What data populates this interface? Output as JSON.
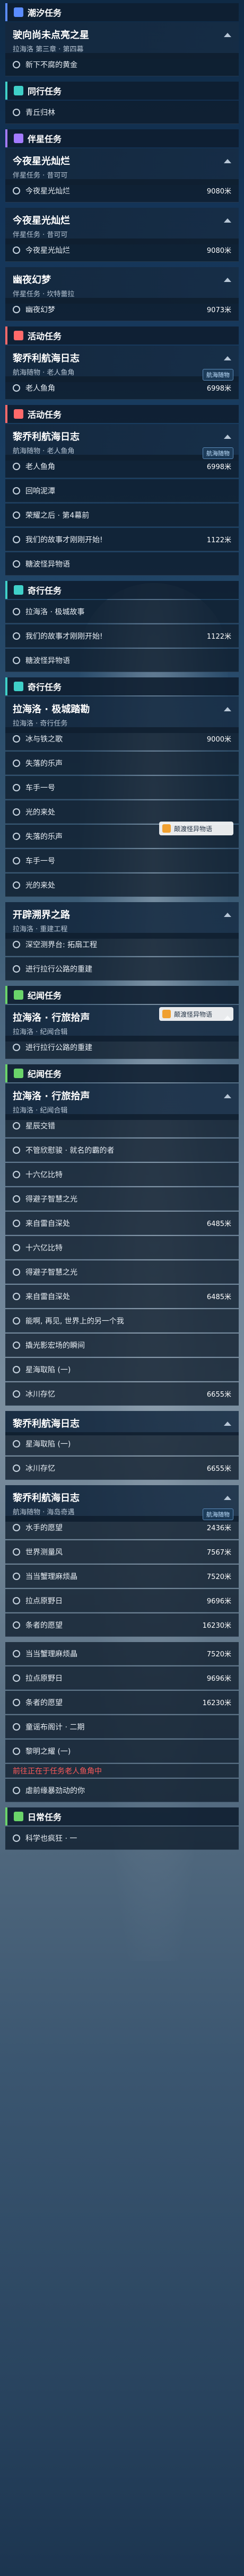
{
  "sections": [
    {
      "cat": "潮汐任务",
      "color": "blue",
      "title": "驶向尚未点亮之星",
      "sub": "拉海洛 第三章 · 第四幕",
      "rows": [
        {
          "label": "新下不腐的黄金"
        }
      ]
    },
    {
      "cat": "同行任务",
      "color": "teal",
      "rows": [
        {
          "label": "青丘归林"
        }
      ]
    },
    {
      "cat": "伴星任务",
      "color": "purple",
      "title": "今夜星光灿烂",
      "sub": "伴星任务 · 昔可可",
      "rows": [
        {
          "label": "今夜星光灿烂",
          "value": "9080米"
        }
      ]
    },
    {
      "cat": "",
      "color": "blue",
      "title": "今夜星光灿烂",
      "sub": "伴星任务 · 昔可可",
      "rows": [
        {
          "label": "今夜星光灿烂",
          "value": "9080米"
        }
      ]
    },
    {
      "cat": "",
      "color": "blue",
      "title": "幽夜幻梦",
      "sub": "伴星任务 · 坎特蕾拉",
      "rows": [
        {
          "label": "幽夜幻梦",
          "value": "9073米"
        }
      ]
    },
    {
      "cat": "活动任务",
      "color": "red",
      "title": "黎乔利航海日志",
      "sub": "航海随物 · 老人鱼角",
      "badge": "航海随物",
      "rows": [
        {
          "label": "老人鱼角",
          "value": "6998米"
        }
      ]
    },
    {
      "cat": "活动任务",
      "color": "red",
      "title": "黎乔利航海日志",
      "sub": "航海随物 · 老人鱼角",
      "badge": "航海随物",
      "rows": [
        {
          "label": "老人鱼角",
          "value": "6998米"
        },
        {
          "label": "回响泥潭"
        },
        {
          "label": "荣耀之后 · 第4幕前"
        },
        {
          "label": "我们的故事才刚刚开始!",
          "value": "1122米"
        },
        {
          "label": "糖波怪异物语"
        }
      ]
    },
    {
      "cat": "奇行任务",
      "color": "teal",
      "rows": [
        {
          "label": "拉海洛 · 极城故事"
        },
        {
          "label": "我们的故事才刚刚开始!",
          "value": "1122米"
        },
        {
          "label": "糖波怪异物语"
        }
      ]
    },
    {
      "cat": "奇行任务",
      "color": "teal",
      "title": "拉海洛 · 极城踏勘",
      "sub": "拉海洛 · 奇行任务",
      "rows": [
        {
          "label": "冰与铁之歌",
          "value": "9000米"
        },
        {
          "label": "失落的乐声"
        },
        {
          "label": "车手一号"
        },
        {
          "label": "光的来处"
        },
        {
          "label": "失落的乐声"
        },
        {
          "label": "车手一号"
        },
        {
          "label": "光的来处"
        }
      ]
    },
    {
      "cat": "",
      "color": "blue",
      "title": "开辟溯界之路",
      "sub": "拉海洛 · 重建工程",
      "rows": [
        {
          "label": "深空测界台: 拓扇工程"
        },
        {
          "label": "进行拉行公路的重建"
        }
      ]
    },
    {
      "cat": "纪闻任务",
      "color": "green",
      "title": "拉海洛 · 行旅拾声",
      "sub": "拉海洛 · 纪闻合辑",
      "rows": [
        {
          "label": "进行拉行公路的重建"
        }
      ]
    },
    {
      "cat": "纪闻任务",
      "color": "green",
      "title": "拉海洛 · 行旅拾声",
      "sub": "拉海洛 · 纪闻合辑",
      "rows": [
        {
          "label": "星辰交错"
        },
        {
          "label": "不管欣慰骏 · 就名的霸的者"
        },
        {
          "label": "十六亿比特"
        },
        {
          "label": "得避子智慧之光"
        },
        {
          "label": "来自雷自深处",
          "value": "6485米"
        },
        {
          "label": "十六亿比特"
        },
        {
          "label": "得避子智慧之光"
        },
        {
          "label": "来自雷自深处",
          "value": "6485米"
        },
        {
          "label": "能啊, 再见, 世界上的另一个我"
        },
        {
          "label": "撬光影宏场的瞬间"
        },
        {
          "label": "星海取陷 (一)"
        },
        {
          "label": "冰川存忆",
          "value": "6655米"
        }
      ]
    },
    {
      "cat": "",
      "color": "blue",
      "title": "黎乔利航海日志",
      "sub": "",
      "rows": [
        {
          "label": "星海取陷 (一)"
        },
        {
          "label": "冰川存忆",
          "value": "6655米"
        }
      ]
    },
    {
      "cat": "",
      "color": "blue",
      "title": "黎乔利航海日志",
      "sub": "航海随物 · 海岛奇遇",
      "badge": "航海随物",
      "rows": [
        {
          "label": "水手的愿望",
          "value": "2436米"
        },
        {
          "label": "世界测量风",
          "value": "7567米"
        },
        {
          "label": "当当蟹理麻烦晶",
          "value": "7520米"
        },
        {
          "label": "拉点原野日",
          "value": "9696米"
        },
        {
          "label": "条者的愿望",
          "value": "16230米"
        }
      ]
    },
    {
      "cat": "",
      "color": "blue",
      "rows": [
        {
          "label": "当当蟹理麻烦晶",
          "value": "7520米"
        },
        {
          "label": "拉点原野日",
          "value": "9696米"
        },
        {
          "label": "条者的愿望",
          "value": "16230米"
        },
        {
          "label": "童谣布阁计 · 二期"
        },
        {
          "label": "黎明之耀 (一)",
          "hl": "前往正在于任务老人鱼角中"
        },
        {
          "label": "虐前缘暴劲动的你"
        }
      ]
    },
    {
      "cat": "日常任务",
      "color": "green",
      "rows": [
        {
          "label": "科学也疯狂 · 一"
        }
      ]
    }
  ],
  "hint": "颠渡怪异物语"
}
